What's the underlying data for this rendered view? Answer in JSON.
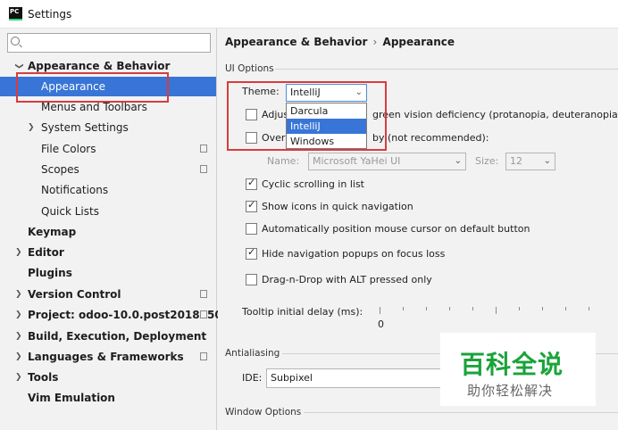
{
  "window": {
    "app_icon": "PC",
    "title": "Settings"
  },
  "search": {
    "placeholder": ""
  },
  "sidebar": {
    "items": [
      {
        "label": "Appearance & Behavior"
      },
      {
        "label": "Appearance"
      },
      {
        "label": "Menus and Toolbars"
      },
      {
        "label": "System Settings"
      },
      {
        "label": "File Colors"
      },
      {
        "label": "Scopes"
      },
      {
        "label": "Notifications"
      },
      {
        "label": "Quick Lists"
      },
      {
        "label": "Keymap"
      },
      {
        "label": "Editor"
      },
      {
        "label": "Plugins"
      },
      {
        "label": "Version Control"
      },
      {
        "label": "Project: odoo-10.0.post2018050..."
      },
      {
        "label": "Build, Execution, Deployment"
      },
      {
        "label": "Languages & Frameworks"
      },
      {
        "label": "Tools"
      },
      {
        "label": "Vim Emulation"
      }
    ]
  },
  "main": {
    "breadcrumb": {
      "parent": "Appearance & Behavior",
      "separator": "›",
      "current": "Appearance"
    },
    "ui_options": {
      "group_title": "UI Options",
      "theme_label": "Theme:",
      "theme_value": "IntelliJ",
      "theme_options": [
        "Darcula",
        "IntelliJ",
        "Windows"
      ],
      "adjust_label_start": "Adjus",
      "adjust_label_end": "green vision deficiency (protanopia, deuteranopia)",
      "override_label_start": "Over",
      "override_label_end": "by (not recommended):",
      "font_name_label": "Name:",
      "font_name_value": "Microsoft YaHei UI",
      "font_size_label": "Size:",
      "font_size_value": "12",
      "cyclic_scrolling": "Cyclic scrolling in list",
      "show_icons": "Show icons in quick navigation",
      "auto_position": "Automatically position mouse cursor on default button",
      "hide_popups": "Hide navigation popups on focus loss",
      "drag_drop": "Drag-n-Drop with ALT pressed only",
      "tooltip_label": "Tooltip initial delay (ms):",
      "tooltip_value": "0"
    },
    "antialiasing": {
      "group_title": "Antialiasing",
      "ide_label": "IDE:",
      "ide_value": "Subpixel"
    },
    "window_options": {
      "group_title": "Window Options"
    }
  },
  "watermark": {
    "big": "百科全说",
    "small": "助你轻松解决"
  },
  "colors": {
    "selection": "#3875d7",
    "highlight_box": "#d93c3c",
    "watermark_green": "#1aa33a"
  }
}
